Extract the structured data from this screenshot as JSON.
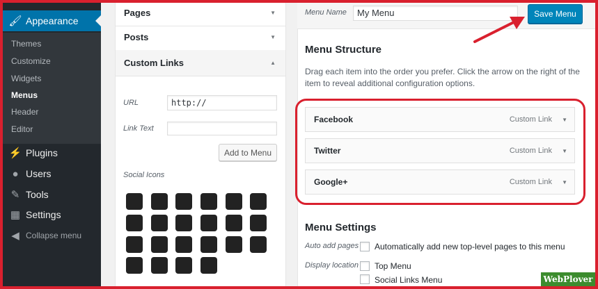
{
  "sidebar": {
    "appearance": "Appearance",
    "sub_items": [
      "Themes",
      "Customize",
      "Widgets",
      "Menus",
      "Header",
      "Editor"
    ],
    "plugins": "Plugins",
    "users": "Users",
    "tools": "Tools",
    "settings": "Settings",
    "collapse": "Collapse menu"
  },
  "left_panel": {
    "pages": "Pages",
    "posts": "Posts",
    "custom_links": "Custom Links",
    "url_label": "URL",
    "url_value": "http://",
    "link_text_label": "Link Text",
    "add_button": "Add to Menu",
    "social_icons": "Social Icons"
  },
  "menu": {
    "name_label": "Menu Name",
    "name_value": "My Menu",
    "save_button": "Save Menu",
    "structure_title": "Menu Structure",
    "structure_desc": "Drag each item into the order you prefer. Click the arrow on the right of the item to reveal additional configuration options.",
    "items": [
      {
        "title": "Facebook",
        "type": "Custom Link"
      },
      {
        "title": "Twitter",
        "type": "Custom Link"
      },
      {
        "title": "Google+",
        "type": "Custom Link"
      }
    ],
    "settings_title": "Menu Settings",
    "auto_add_label": "Auto add pages",
    "auto_add_text": "Automatically add new top-level pages to this menu",
    "display_label": "Display location",
    "locations": [
      "Top Menu",
      "Social Links Menu"
    ]
  },
  "social_icon_names": [
    "foursquare-icon",
    "dribbble-icon",
    "dropbox-icon",
    "facebook-icon",
    "flickr-icon",
    "pocket-icon",
    "github-icon",
    "heart-icon",
    "instagram-icon",
    "linkedin-icon",
    "mail-icon",
    "pinterest-icon",
    "googleplus-icon",
    "tripadvisor-icon",
    "stackoverflow-icon",
    "trello-icon",
    "tumblr-icon",
    "twitter-icon",
    "vk-icon",
    "weibo-icon",
    "xing-icon",
    "youtube-icon"
  ],
  "watermark": "WebPlover",
  "colors": {
    "accent": "#0073aa",
    "primary_button": "#0085ba",
    "annotation": "#d9202e"
  }
}
